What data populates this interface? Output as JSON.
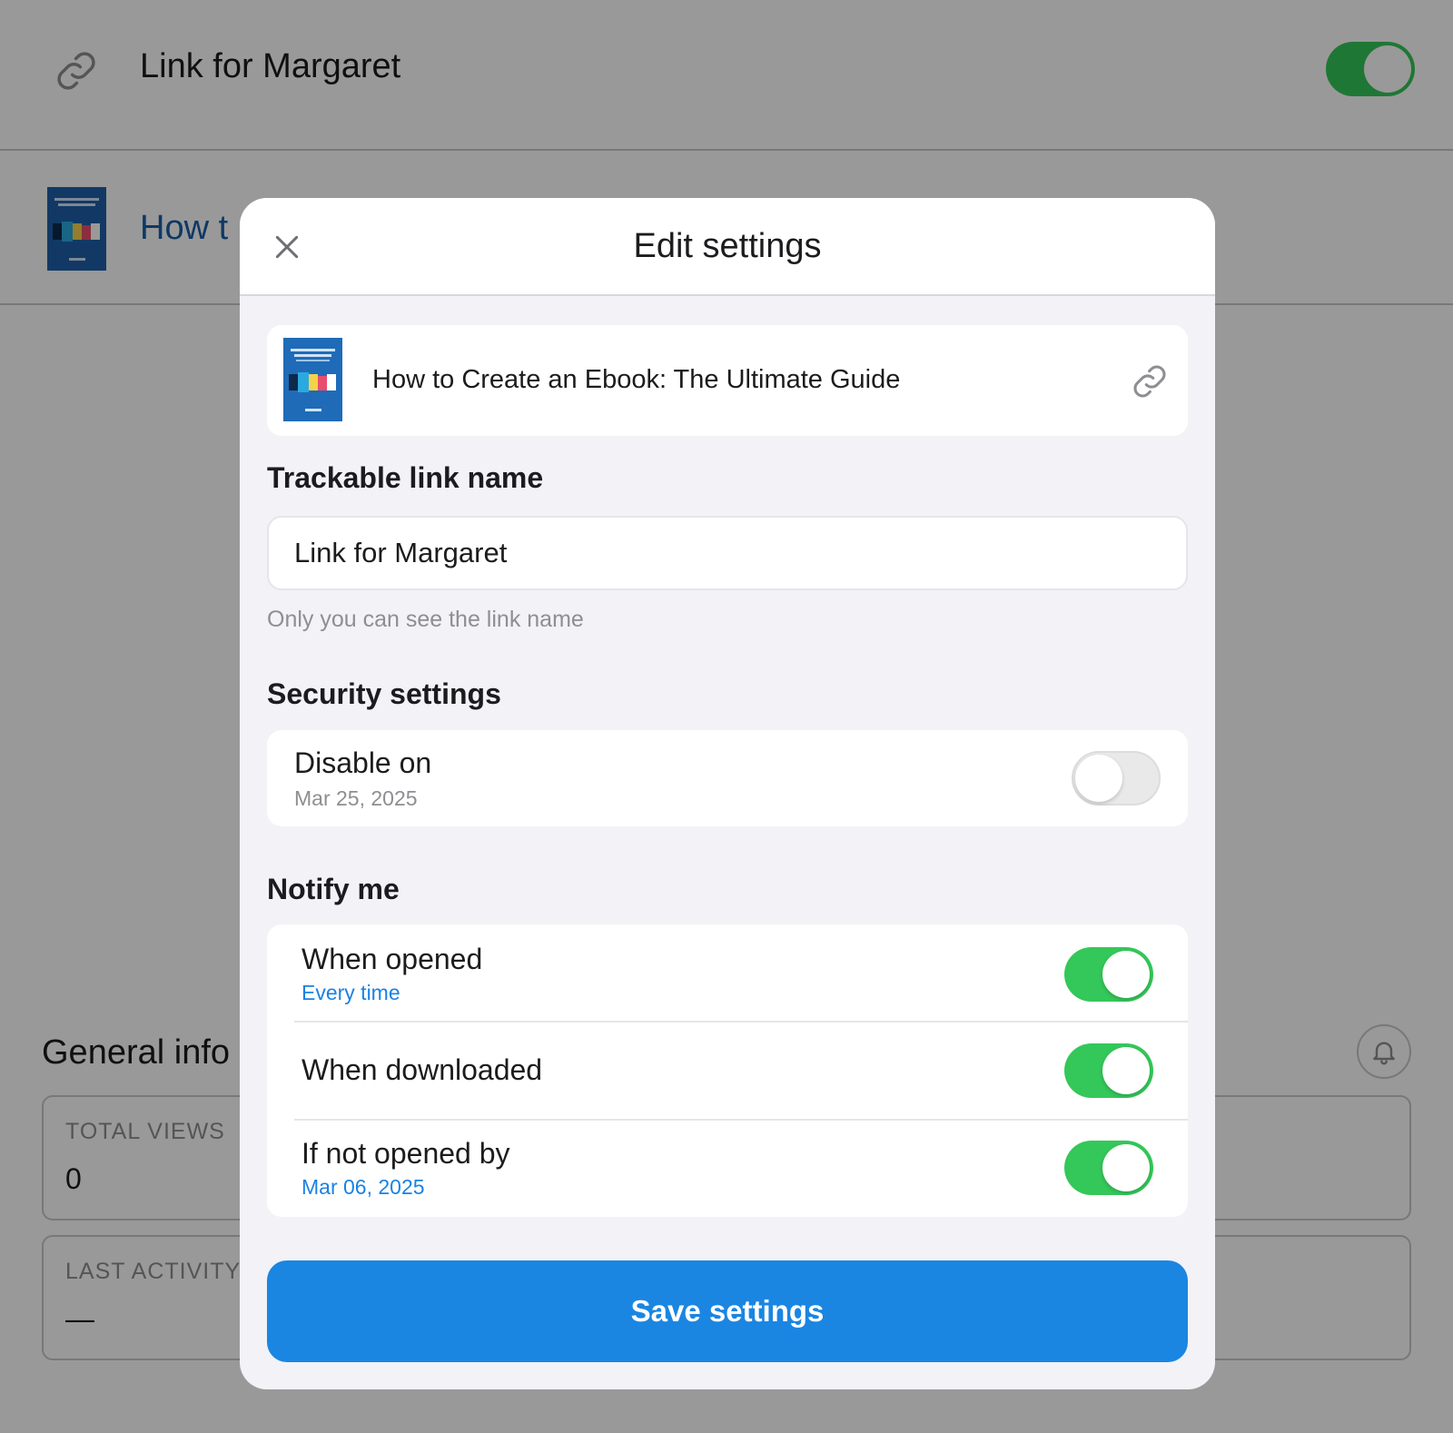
{
  "background": {
    "header_title": "Link for Margaret",
    "header_toggle_on": true,
    "document_title_partial": "How t",
    "general_info_title": "General info",
    "cards": [
      {
        "label": "TOTAL VIEWS",
        "value": "0"
      },
      {
        "label": "LAST ACTIVITY",
        "value": "—"
      }
    ]
  },
  "modal": {
    "title": "Edit settings",
    "document": {
      "title": "How to Create an Ebook: The Ultimate Guide",
      "thumbnail_icon": "ebook-cover",
      "link_icon": "link-icon"
    },
    "trackable": {
      "label": "Trackable link name",
      "value": "Link for Margaret",
      "hint": "Only you can see the link name"
    },
    "security": {
      "label": "Security settings",
      "disable_on": {
        "title": "Disable on",
        "date": "Mar 25, 2025",
        "enabled": false
      }
    },
    "notify": {
      "label": "Notify me",
      "items": [
        {
          "title": "When opened",
          "subtitle": "Every time",
          "enabled": true
        },
        {
          "title": "When downloaded",
          "subtitle": "",
          "enabled": true
        },
        {
          "title": "If not opened by",
          "subtitle": "Mar 06, 2025",
          "enabled": true
        }
      ]
    },
    "save_label": "Save settings"
  },
  "colors": {
    "toggle_on": "#34c759",
    "accent_blue": "#1a86e2",
    "link_blue": "#1a82e2"
  }
}
